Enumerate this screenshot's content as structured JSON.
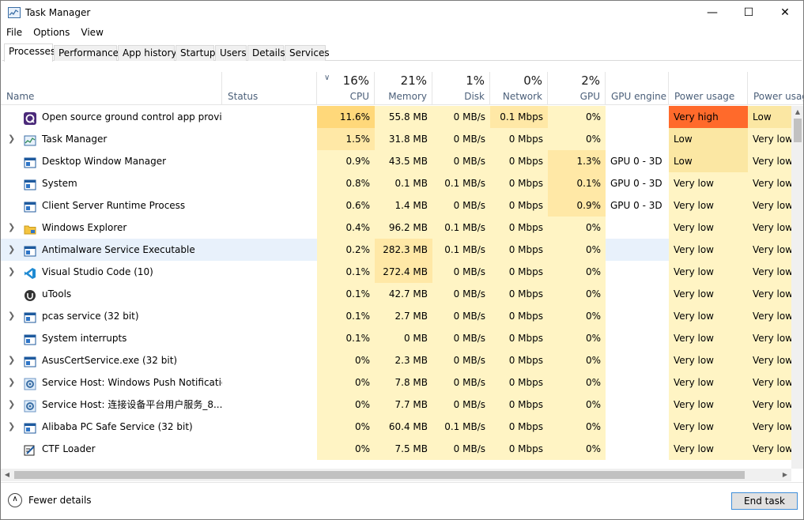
{
  "window": {
    "title": "Task Manager"
  },
  "window_controls": {
    "minimize": "—",
    "maximize": "☐",
    "close": "✕"
  },
  "menu": [
    "File",
    "Options",
    "View"
  ],
  "tabs": [
    "Processes",
    "Performance",
    "App history",
    "Startup",
    "Users",
    "Details",
    "Services"
  ],
  "active_tab": "Processes",
  "columns": {
    "name": "Name",
    "status": "Status",
    "cpu": {
      "pct": "16%",
      "label": "CPU"
    },
    "memory": {
      "pct": "21%",
      "label": "Memory"
    },
    "disk": {
      "pct": "1%",
      "label": "Disk"
    },
    "network": {
      "pct": "0%",
      "label": "Network"
    },
    "gpu": {
      "pct": "2%",
      "label": "GPU"
    },
    "gpu_engine": "GPU engine",
    "power": "Power usage",
    "power_trend": "Power usag"
  },
  "colors": {
    "heat_light": "#fff4c4",
    "heat_mid": "#ffe8a6",
    "heat_strong": "#ffd87a",
    "power_very_high": "#ff6a2b",
    "power_low": "#fbe7a3",
    "power_very_low": "#fff4c4",
    "selected_row": "#e8f1fb"
  },
  "processes": [
    {
      "name": "Open source ground control app provid...",
      "expandable": false,
      "icon": "qgc-icon",
      "cpu": "11.6%",
      "memory": "55.8 MB",
      "disk": "0 MB/s",
      "network": "0.1 Mbps",
      "gpu": "0%",
      "gpu_engine": "",
      "power": "Very high",
      "power_trend": "Low"
    },
    {
      "name": "Task Manager",
      "expandable": true,
      "icon": "taskmgr-icon",
      "cpu": "1.5%",
      "memory": "31.8 MB",
      "disk": "0 MB/s",
      "network": "0 Mbps",
      "gpu": "0%",
      "gpu_engine": "",
      "power": "Low",
      "power_trend": "Very low"
    },
    {
      "name": "Desktop Window Manager",
      "expandable": false,
      "icon": "window-icon",
      "cpu": "0.9%",
      "memory": "43.5 MB",
      "disk": "0 MB/s",
      "network": "0 Mbps",
      "gpu": "1.3%",
      "gpu_engine": "GPU 0 - 3D",
      "power": "Low",
      "power_trend": "Very low"
    },
    {
      "name": "System",
      "expandable": false,
      "icon": "window-icon",
      "cpu": "0.8%",
      "memory": "0.1 MB",
      "disk": "0.1 MB/s",
      "network": "0 Mbps",
      "gpu": "0.1%",
      "gpu_engine": "GPU 0 - 3D",
      "power": "Very low",
      "power_trend": "Very low"
    },
    {
      "name": "Client Server Runtime Process",
      "expandable": false,
      "icon": "window-icon",
      "cpu": "0.6%",
      "memory": "1.4 MB",
      "disk": "0 MB/s",
      "network": "0 Mbps",
      "gpu": "0.9%",
      "gpu_engine": "GPU 0 - 3D",
      "power": "Very low",
      "power_trend": "Very low"
    },
    {
      "name": "Windows Explorer",
      "expandable": true,
      "icon": "folder-icon",
      "cpu": "0.4%",
      "memory": "96.2 MB",
      "disk": "0.1 MB/s",
      "network": "0 Mbps",
      "gpu": "0%",
      "gpu_engine": "",
      "power": "Very low",
      "power_trend": "Very low"
    },
    {
      "name": "Antimalware Service Executable",
      "expandable": true,
      "icon": "window-icon",
      "cpu": "0.2%",
      "memory": "282.3 MB",
      "disk": "0.1 MB/s",
      "network": "0 Mbps",
      "gpu": "0%",
      "gpu_engine": "",
      "power": "Very low",
      "power_trend": "Very low",
      "highlighted": true
    },
    {
      "name": "Visual Studio Code (10)",
      "expandable": true,
      "icon": "vscode-icon",
      "cpu": "0.1%",
      "memory": "272.4 MB",
      "disk": "0 MB/s",
      "network": "0 Mbps",
      "gpu": "0%",
      "gpu_engine": "",
      "power": "Very low",
      "power_trend": "Very low"
    },
    {
      "name": "uTools",
      "expandable": false,
      "icon": "utools-icon",
      "cpu": "0.1%",
      "memory": "42.7 MB",
      "disk": "0 MB/s",
      "network": "0 Mbps",
      "gpu": "0%",
      "gpu_engine": "",
      "power": "Very low",
      "power_trend": "Very low"
    },
    {
      "name": "pcas service (32 bit)",
      "expandable": true,
      "icon": "window-icon",
      "cpu": "0.1%",
      "memory": "2.7 MB",
      "disk": "0 MB/s",
      "network": "0 Mbps",
      "gpu": "0%",
      "gpu_engine": "",
      "power": "Very low",
      "power_trend": "Very low"
    },
    {
      "name": "System interrupts",
      "expandable": false,
      "icon": "window-icon",
      "cpu": "0.1%",
      "memory": "0 MB",
      "disk": "0 MB/s",
      "network": "0 Mbps",
      "gpu": "0%",
      "gpu_engine": "",
      "power": "Very low",
      "power_trend": "Very low"
    },
    {
      "name": "AsusCertService.exe (32 bit)",
      "expandable": true,
      "icon": "window-icon",
      "cpu": "0%",
      "memory": "2.3 MB",
      "disk": "0 MB/s",
      "network": "0 Mbps",
      "gpu": "0%",
      "gpu_engine": "",
      "power": "Very low",
      "power_trend": "Very low"
    },
    {
      "name": "Service Host: Windows Push Notificatio...",
      "expandable": true,
      "icon": "gear-icon",
      "cpu": "0%",
      "memory": "7.8 MB",
      "disk": "0 MB/s",
      "network": "0 Mbps",
      "gpu": "0%",
      "gpu_engine": "",
      "power": "Very low",
      "power_trend": "Very low"
    },
    {
      "name": "Service Host: 连接设备平台用户服务_8...",
      "expandable": true,
      "icon": "gear-icon",
      "cpu": "0%",
      "memory": "7.7 MB",
      "disk": "0 MB/s",
      "network": "0 Mbps",
      "gpu": "0%",
      "gpu_engine": "",
      "power": "Very low",
      "power_trend": "Very low"
    },
    {
      "name": "Alibaba PC Safe Service (32 bit)",
      "expandable": true,
      "icon": "window-icon",
      "cpu": "0%",
      "memory": "60.4 MB",
      "disk": "0.1 MB/s",
      "network": "0 Mbps",
      "gpu": "0%",
      "gpu_engine": "",
      "power": "Very low",
      "power_trend": "Very low"
    },
    {
      "name": "CTF Loader",
      "expandable": false,
      "icon": "ctf-icon",
      "cpu": "0%",
      "memory": "7.5 MB",
      "disk": "0 MB/s",
      "network": "0 Mbps",
      "gpu": "0%",
      "gpu_engine": "",
      "power": "Very low",
      "power_trend": "Very low"
    }
  ],
  "footer": {
    "fewer_details": "Fewer details",
    "end_task": "End task"
  }
}
